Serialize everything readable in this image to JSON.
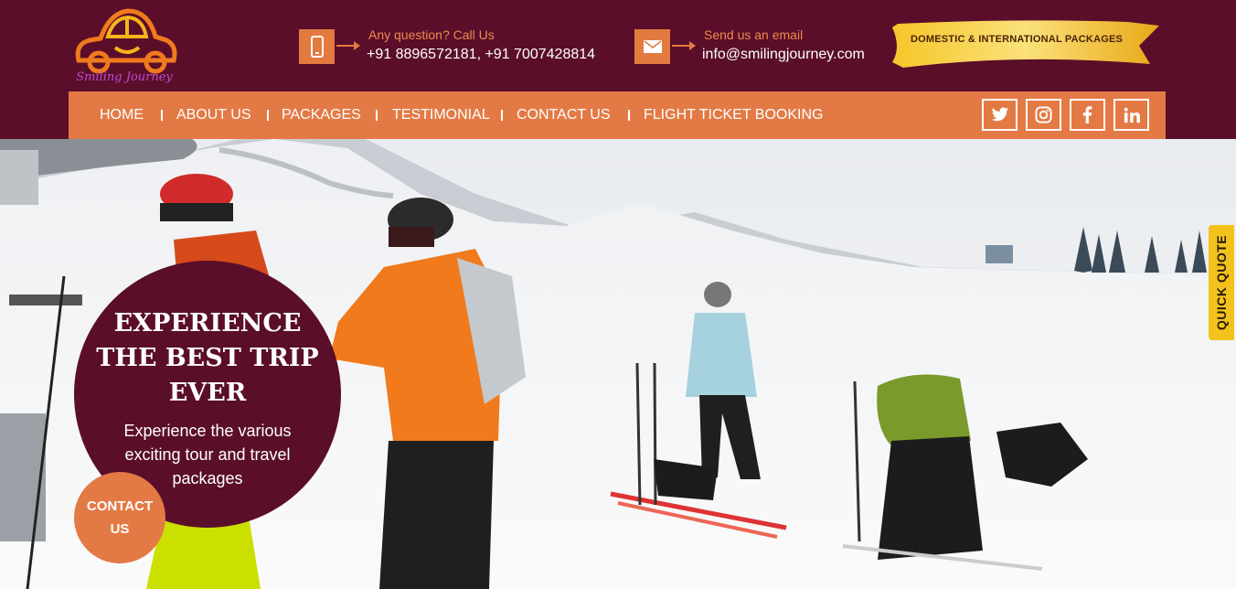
{
  "brand": {
    "logo_text": "Smiling Journey",
    "colors": {
      "maroon": "#5a0e2a",
      "orange": "#e37a45",
      "gold": "#f2c31d"
    }
  },
  "header": {
    "phone": {
      "icon": "mobile-phone-icon",
      "label": "Any question? Call Us",
      "value": "+91 8896572181, +91 7007428814"
    },
    "email": {
      "icon": "envelope-icon",
      "label": "Send us an email",
      "value": "info@smilingjourney.com"
    },
    "ribbon": "DOMESTIC & INTERNATIONAL PACKAGES"
  },
  "nav": {
    "items": [
      "HOME",
      "ABOUT US",
      "PACKAGES",
      "TESTIMONIAL",
      "CONTACT US",
      "FLIGHT TICKET BOOKING"
    ],
    "social": [
      "twitter-icon",
      "instagram-icon",
      "facebook-icon",
      "linkedin-icon"
    ]
  },
  "hero": {
    "title": "EXPERIENCE THE BEST TRIP EVER",
    "subtitle": "Experience the various exciting tour and travel packages",
    "contact_button": "CONTACT US",
    "quick_quote": "QUICK QUOTE"
  }
}
